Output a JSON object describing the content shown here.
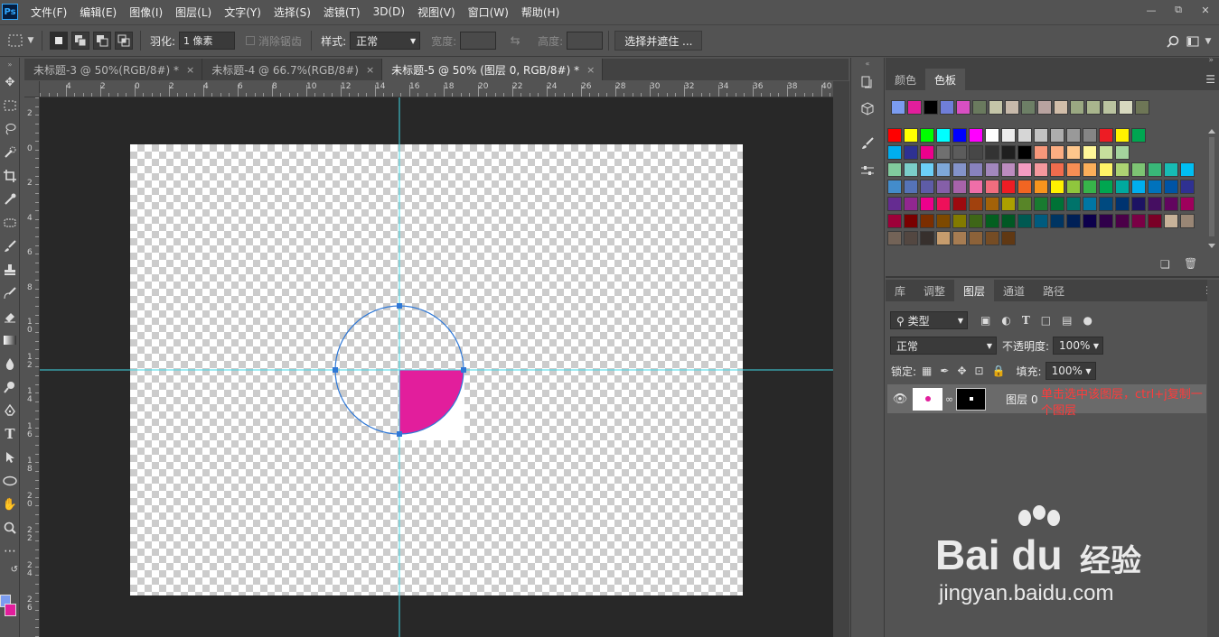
{
  "menu": {
    "logo": "Ps",
    "items": [
      "文件(F)",
      "编辑(E)",
      "图像(I)",
      "图层(L)",
      "文字(Y)",
      "选择(S)",
      "滤镜(T)",
      "3D(D)",
      "视图(V)",
      "窗口(W)",
      "帮助(H)"
    ]
  },
  "options": {
    "feather_label": "羽化:",
    "feather_value": "1 像素",
    "antialias_label": "消除锯齿",
    "style_label": "样式:",
    "style_value": "正常",
    "width_label": "宽度:",
    "height_label": "高度:",
    "select_mask_button": "选择并遮住 ..."
  },
  "tabs": [
    {
      "label": "未标题-3 @ 50%(RGB/8#) *",
      "close": "×"
    },
    {
      "label": "未标题-4 @ 66.7%(RGB/8#)",
      "close": "×"
    },
    {
      "label": "未标题-5 @ 50% (图层 0, RGB/8#) *",
      "close": "×"
    }
  ],
  "ruler_top_labels": [
    "4",
    "2",
    "0",
    "2",
    "4",
    "6",
    "8",
    "10",
    "12",
    "14",
    "16",
    "18",
    "20",
    "22",
    "24",
    "26",
    "28",
    "30",
    "32",
    "34",
    "36",
    "38",
    "40"
  ],
  "ruler_left_labels": [
    "2",
    "0",
    "2",
    "4",
    "6",
    "8",
    "1\n0",
    "1\n2",
    "1\n4",
    "1\n6",
    "1\n8",
    "2\n0",
    "2\n2",
    "2\n4",
    "2\n6"
  ],
  "swatches_panel": {
    "tabs": [
      "颜色",
      "色板"
    ],
    "recent": [
      "#7b9cf0",
      "#e21e9c",
      "#000000",
      "#6f7ed8",
      "#d84fc2",
      "#6a7a5e",
      "#c4c5a8",
      "#c7b9aa",
      "#6d7f66",
      "#b8a3a0",
      "#d1bda9",
      "#9aa882",
      "#a9b58d",
      "#bac3a0",
      "#d7d9bf",
      "#6e7656"
    ],
    "rows": [
      [
        "#ff0000",
        "#ffff00",
        "#00ff00",
        "#00ffff",
        "#0000ff",
        "#ff00ff",
        "#ffffff",
        "#ebebeb",
        "#d6d6d6",
        "#c2c2c2",
        "#adadad",
        "#999999",
        "#858585",
        "#ed1c24",
        "#fff200",
        "#00a651"
      ],
      [
        "#00aeef",
        "#2e3192",
        "#ec008c",
        "#707070",
        "#5c5c5c",
        "#474747",
        "#333333",
        "#1f1f1f",
        "#000000",
        "#f7977a",
        "#fbad82",
        "#fdc68c",
        "#fff799",
        "#c6df9c",
        "#a4d49d"
      ],
      [
        "#81ca9d",
        "#7bcdc9",
        "#6ccff7",
        "#7ea7d8",
        "#8493ca",
        "#8882be",
        "#a287bd",
        "#bc8cbf",
        "#f49bc1",
        "#f5989d",
        "#f16c4d",
        "#f68e54",
        "#fbaf5a",
        "#fff467",
        "#acd372",
        "#7dc473",
        "#39b778",
        "#17bcb4",
        "#00bef2"
      ],
      [
        "#438ccb",
        "#5573b7",
        "#5e5ca7",
        "#855fa8",
        "#a763a9",
        "#ef6ea8",
        "#f16d7e",
        "#ee1d24",
        "#f16522",
        "#f7941d",
        "#fff100",
        "#8fc63d",
        "#37b44a",
        "#00a650",
        "#00a99e",
        "#00aeef",
        "#0072bc",
        "#0054a5",
        "#2f3192"
      ],
      [
        "#652c91",
        "#91278f",
        "#ed008c",
        "#ee105a",
        "#9d0a0f",
        "#a1410d",
        "#a36209",
        "#aba000",
        "#588528",
        "#197b30",
        "#007236",
        "#00736a",
        "#0076a4",
        "#004a80",
        "#003370",
        "#1d1363",
        "#450e61",
        "#62055f",
        "#9e005c"
      ],
      [
        "#9d0039",
        "#790000",
        "#7b2e00",
        "#7d4900",
        "#827a00",
        "#3e6617",
        "#045f20",
        "#005824",
        "#005951",
        "#005b7e",
        "#003562",
        "#002056",
        "#0c004b",
        "#30004a",
        "#4b0048",
        "#7a0045",
        "#7a0026",
        "#c7b299",
        "#998675"
      ],
      [
        "#736357",
        "#534741",
        "#37302d",
        "#c69c6d",
        "#a67c52",
        "#8c6239",
        "#754c24",
        "#603813"
      ]
    ]
  },
  "layers_panel": {
    "tabs": [
      "库",
      "调整",
      "图层",
      "通道",
      "路径"
    ],
    "filter_label": "类型",
    "blend_mode": "正常",
    "opacity_label": "不透明度:",
    "opacity_value": "100%",
    "lock_label": "锁定:",
    "fill_label": "填充:",
    "fill_value": "100%",
    "layer_name": "图层 0",
    "annotation": "单击选中该图层，ctrl+j复制一个图层"
  },
  "watermark": {
    "logo": "Bai du",
    "jy": "经验",
    "url": "jingyan.baidu.com"
  },
  "colors": {
    "shape_fill": "#e21e9c",
    "guide": "#3fd7e6",
    "path": "#2f78d6"
  }
}
